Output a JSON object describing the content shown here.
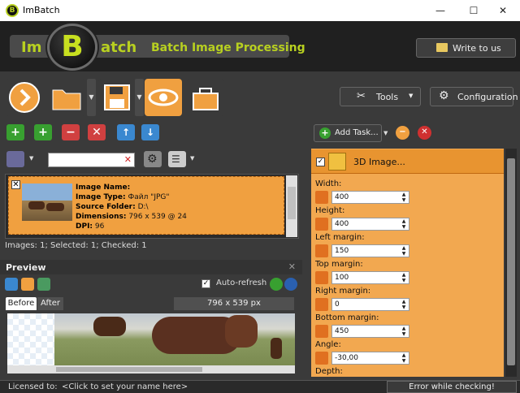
{
  "window": {
    "title": "ImBatch",
    "minimize": "—",
    "maximize": "☐",
    "close": "✕"
  },
  "logo": {
    "prefix": "Im",
    "letter": "B",
    "suffix": "atch",
    "tagline": "Batch Image Processing"
  },
  "header": {
    "write_label": "Write to us"
  },
  "toolbar": {
    "tools_label": "Tools",
    "config_label": "Configuration"
  },
  "image_list": {
    "item": {
      "name_label": "Image Name:",
      "name_value": "",
      "type_label": "Image Type:",
      "type_value": "Файл \"JPG\"",
      "folder_label": "Source Folder:",
      "folder_value": "D:\\",
      "dims_label": "Dimensions:",
      "dims_value": "796 x 539 @ 24",
      "dpi_label": "DPI:",
      "dpi_value": "96"
    },
    "counts": "Images: 1; Selected: 1; Checked: 1"
  },
  "preview": {
    "title": "Preview",
    "auto_refresh": "Auto-refresh",
    "tab_before": "Before",
    "tab_after": "After",
    "dims": "796 x 539 px"
  },
  "tasks": {
    "add_label": "Add Task...",
    "task_name": "3D Image...",
    "params": [
      {
        "label": "Width:",
        "value": "400"
      },
      {
        "label": "Height:",
        "value": "400"
      },
      {
        "label": "Left margin:",
        "value": "150"
      },
      {
        "label": "Top margin:",
        "value": "100"
      },
      {
        "label": "Right margin:",
        "value": "0"
      },
      {
        "label": "Bottom margin:",
        "value": "450"
      },
      {
        "label": "Angle:",
        "value": "-30,00"
      }
    ],
    "last_label": "Depth:"
  },
  "status": {
    "licensed": "Licensed to:",
    "click_name": "<Click to set your name here>",
    "error": "Error while checking!"
  },
  "colors": {
    "accent": "#f0a040",
    "logo": "#b8d020",
    "panel": "#3a3a3a"
  }
}
